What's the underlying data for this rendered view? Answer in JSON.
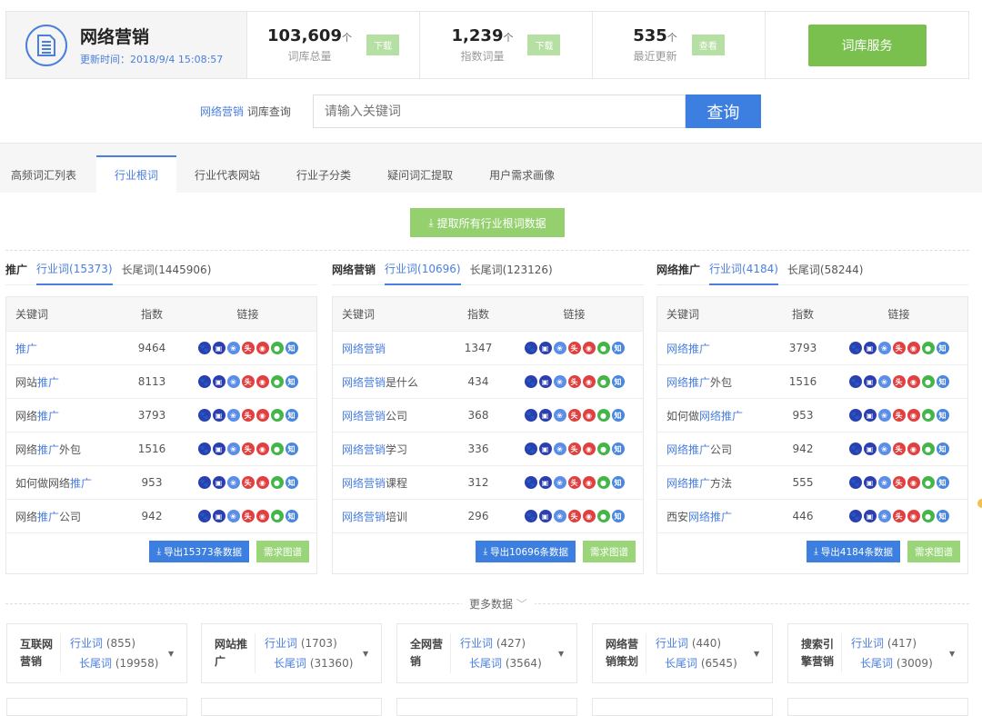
{
  "header": {
    "title": "网络营销",
    "update_time": "更新时间：2018/9/4 15:08:57",
    "stats": [
      {
        "value": "103,609",
        "unit": "个",
        "label": "词库总量",
        "action": "下载"
      },
      {
        "value": "1,239",
        "unit": "个",
        "label": "指数词量",
        "action": "下载"
      },
      {
        "value": "535",
        "unit": "个",
        "label": "最近更新",
        "action": "查看"
      }
    ],
    "service_button": "词库服务"
  },
  "query": {
    "keyword": "网络营销",
    "label": "词库查询",
    "placeholder": "请输入关键词",
    "button": "查询"
  },
  "tabs": [
    "高频词汇列表",
    "行业根词",
    "行业代表网站",
    "行业子分类",
    "疑问词汇提取",
    "用户需求画像"
  ],
  "active_tab": "行业根词",
  "extract_button": "提取所有行业根词数据",
  "table_headers": {
    "keyword": "关键词",
    "index": "指数",
    "links": "链接"
  },
  "link_icons": [
    {
      "name": "baidu-icon",
      "glyph": "🐾",
      "color": "#2b3fb0"
    },
    {
      "name": "mobile-icon",
      "glyph": "▣",
      "color": "#2b3fb0"
    },
    {
      "name": "360-icon",
      "glyph": "❀",
      "color": "#5b8ee8"
    },
    {
      "name": "toutiao-icon",
      "glyph": "头",
      "color": "#e04040"
    },
    {
      "name": "weibo-icon",
      "glyph": "◉",
      "color": "#e04040"
    },
    {
      "name": "wechat-icon",
      "glyph": "●",
      "color": "#44b549"
    },
    {
      "name": "zhihu-icon",
      "glyph": "知",
      "color": "#4a87dd"
    }
  ],
  "columns": [
    {
      "name": "推广",
      "industry_tab": "行业词(15373)",
      "longtail_tab": "长尾词(1445906)",
      "rows": [
        {
          "pre": "",
          "hl": "推广",
          "post": "",
          "index": "9464"
        },
        {
          "pre": "网站",
          "hl": "推广",
          "post": "",
          "index": "8113"
        },
        {
          "pre": "网络",
          "hl": "推广",
          "post": "",
          "index": "3793"
        },
        {
          "pre": "网络",
          "hl": "推广",
          "post": "外包",
          "index": "1516"
        },
        {
          "pre": "如何做网络",
          "hl": "推广",
          "post": "",
          "index": "953"
        },
        {
          "pre": "网络",
          "hl": "推广",
          "post": "公司",
          "index": "942"
        }
      ],
      "export": "导出15373条数据",
      "map": "需求图谱"
    },
    {
      "name": "网络营销",
      "industry_tab": "行业词(10696)",
      "longtail_tab": "长尾词(123126)",
      "rows": [
        {
          "pre": "",
          "hl": "网络营销",
          "post": "",
          "index": "1347"
        },
        {
          "pre": "",
          "hl": "网络营销",
          "post": "是什么",
          "index": "434"
        },
        {
          "pre": "",
          "hl": "网络营销",
          "post": "公司",
          "index": "368"
        },
        {
          "pre": "",
          "hl": "网络营销",
          "post": "学习",
          "index": "336"
        },
        {
          "pre": "",
          "hl": "网络营销",
          "post": "课程",
          "index": "312"
        },
        {
          "pre": "",
          "hl": "网络营销",
          "post": "培训",
          "index": "296"
        }
      ],
      "export": "导出10696条数据",
      "map": "需求图谱"
    },
    {
      "name": "网络推广",
      "industry_tab": "行业词(4184)",
      "longtail_tab": "长尾词(58244)",
      "rows": [
        {
          "pre": "",
          "hl": "网络推广",
          "post": "",
          "index": "3793"
        },
        {
          "pre": "",
          "hl": "网络推广",
          "post": "外包",
          "index": "1516"
        },
        {
          "pre": "如何做",
          "hl": "网络推广",
          "post": "",
          "index": "953"
        },
        {
          "pre": "",
          "hl": "网络推广",
          "post": "公司",
          "index": "942"
        },
        {
          "pre": "",
          "hl": "网络推广",
          "post": "方法",
          "index": "555"
        },
        {
          "pre": "西安",
          "hl": "网络推广",
          "post": "",
          "index": "446"
        }
      ],
      "export": "导出4184条数据",
      "map": "需求图谱"
    }
  ],
  "more_data": "更多数据",
  "cards": [
    {
      "name": "互联网营销",
      "industry_label": "行业词",
      "industry_count": "(855)",
      "longtail_label": "长尾词",
      "longtail_count": "(19958)"
    },
    {
      "name": "网站推广",
      "industry_label": "行业词",
      "industry_count": "(1703)",
      "longtail_label": "长尾词",
      "longtail_count": "(31360)"
    },
    {
      "name": "全网营销",
      "industry_label": "行业词",
      "industry_count": "(427)",
      "longtail_label": "长尾词",
      "longtail_count": "(3564)"
    },
    {
      "name": "网络营销策划",
      "industry_label": "行业词",
      "industry_count": "(440)",
      "longtail_label": "长尾词",
      "longtail_count": "(6545)"
    },
    {
      "name": "搜索引擎营销",
      "industry_label": "行业词",
      "industry_count": "(417)",
      "longtail_label": "长尾词",
      "longtail_count": "(3009)"
    }
  ]
}
